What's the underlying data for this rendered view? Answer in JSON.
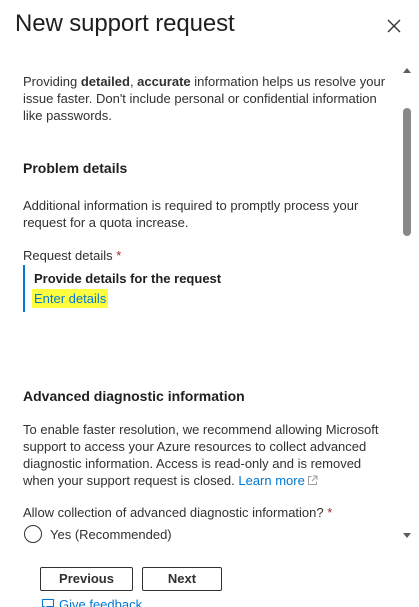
{
  "panel": {
    "title": "New support request",
    "close_icon": "close-icon"
  },
  "intro": {
    "part1": "Providing ",
    "bold1": "detailed",
    "part2": ", ",
    "bold2": "accurate",
    "part3": " information helps us resolve your issue faster. Don't include personal or confidential information like passwords."
  },
  "problem_details": {
    "heading": "Problem details",
    "description": "Additional information is required to promptly process your request for a quota increase.",
    "request_label": "Request details",
    "required_marker": "*",
    "box_title": "Provide details for the request",
    "enter_details_link": "Enter details"
  },
  "advanced": {
    "heading": "Advanced diagnostic information",
    "description": "To enable faster resolution, we recommend allowing Microsoft support to access your Azure resources to collect advanced diagnostic information. Access is read-only and is removed when your support request is closed.",
    "learn_more": "Learn more",
    "allow_label": "Allow collection of advanced diagnostic information?",
    "required_marker": "*",
    "option_yes": "Yes (Recommended)"
  },
  "footer": {
    "previous_label": "Previous",
    "next_label": "Next",
    "feedback_label": "Give feedback"
  },
  "colors": {
    "link": "#0078d4",
    "highlight": "#ffff3f",
    "required": "#a4262c",
    "accent_border": "#0078d4"
  }
}
